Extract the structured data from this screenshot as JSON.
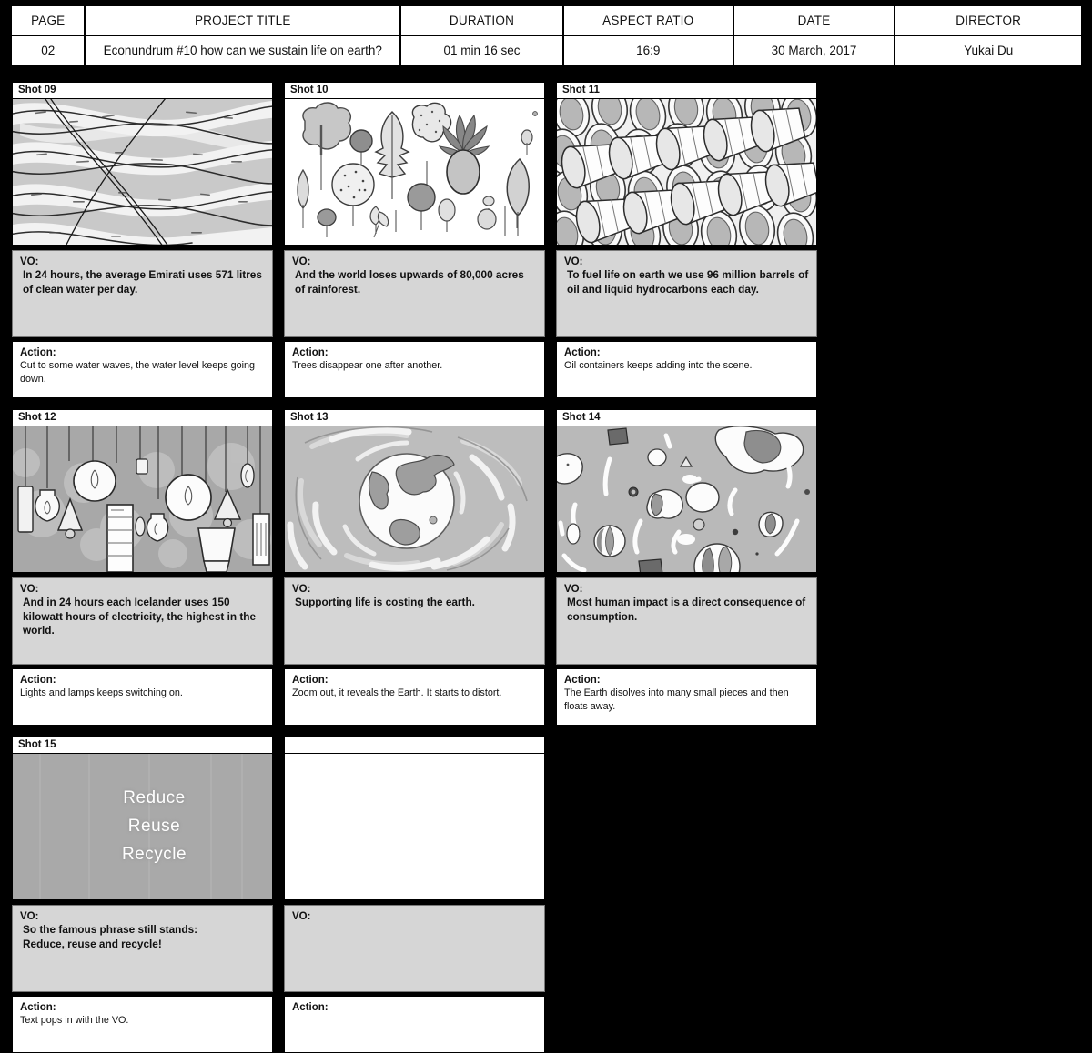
{
  "info": {
    "columns": [
      {
        "header": "PAGE",
        "value": "02"
      },
      {
        "header": "PROJECT TITLE",
        "value": "Econundrum #10 how can we sustain life on earth?"
      },
      {
        "header": "DURATION",
        "value": "01 min 16 sec"
      },
      {
        "header": "ASPECT RATIO",
        "value": "16:9"
      },
      {
        "header": "DATE",
        "value": "30 March, 2017"
      },
      {
        "header": "DIRECTOR",
        "value": "Yukai Du"
      }
    ]
  },
  "labels": {
    "vo": "VO:",
    "action": "Action:"
  },
  "colors": {
    "page_background": "#000000",
    "panel_background": "#ffffff",
    "vo_background": "#d6d6d6",
    "text": "#111111"
  },
  "shots": [
    {
      "label": "Shot 09",
      "art": "water-waves",
      "vo": "In 24 hours, the average Emirati uses 571 litres of clean water per day.",
      "action": "Cut to some water waves, the water level keeps going down."
    },
    {
      "label": "Shot 10",
      "art": "trees-and-leaves",
      "vo": "And the world loses upwards of 80,000 acres of rainforest.",
      "action": "Trees disappear one after another."
    },
    {
      "label": "Shot 11",
      "art": "oil-barrels",
      "vo": "To fuel life on earth we use 96 million barrels of oil and liquid hydrocarbons each day.",
      "action": "Oil containers keeps adding into the scene."
    },
    {
      "label": "Shot 12",
      "art": "hanging-lamps",
      "vo": "And in 24 hours each Icelander uses 150 kilowatt hours of electricity, the highest in the world.",
      "action": "Lights and lamps keeps switching on."
    },
    {
      "label": "Shot 13",
      "art": "earth-distorting",
      "vo": "Supporting life is costing the earth.",
      "action": "Zoom out, it reveals the Earth. It starts to distort."
    },
    {
      "label": "Shot 14",
      "art": "earth-dissolved-pieces",
      "vo": "Most human impact is a direct consequence of consumption.",
      "action": "The Earth disolves into many small pieces and then floats away."
    },
    {
      "label": "Shot 15",
      "art": "reduce-reuse-recycle-text",
      "vo": "So the famous phrase still stands:\nReduce, reuse and recycle!",
      "action": "Text pops in with the VO.",
      "onscreen_text": [
        "Reduce",
        "Reuse",
        "Recycle"
      ]
    },
    {
      "label": "",
      "art": "empty",
      "vo": "",
      "action": ""
    }
  ]
}
